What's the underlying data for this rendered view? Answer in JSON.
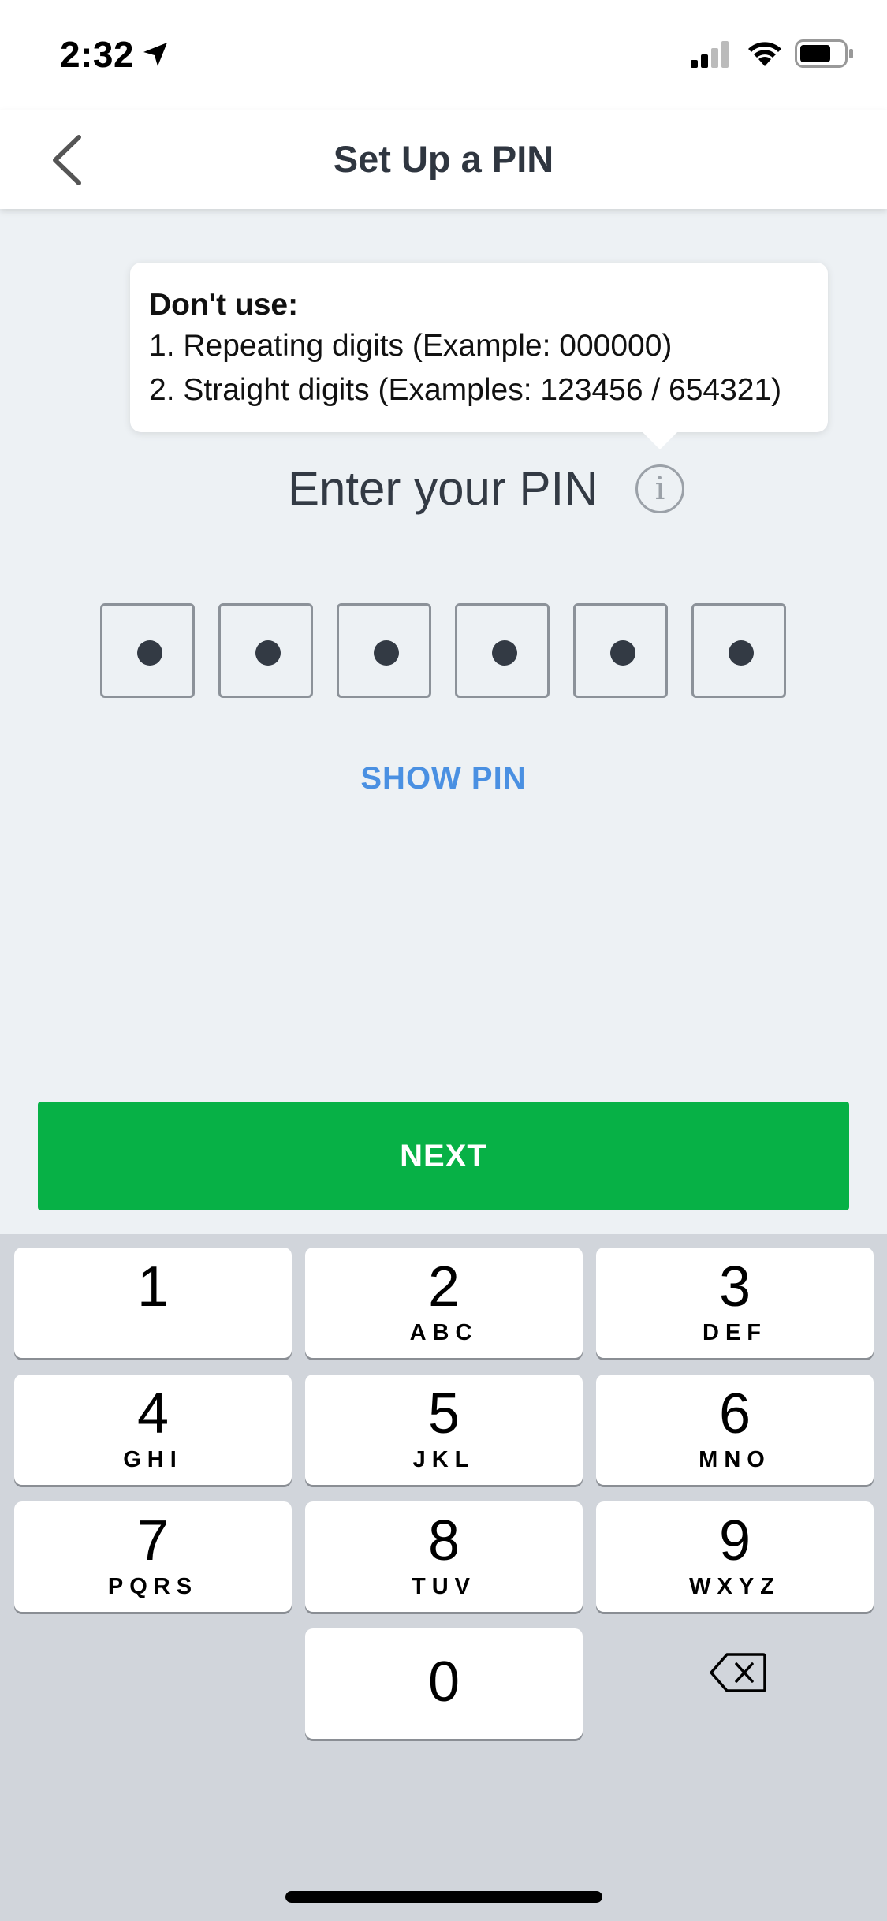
{
  "status_bar": {
    "time": "2:32",
    "icons": [
      "location-arrow-icon",
      "signal-icon",
      "wifi-icon",
      "battery-icon"
    ]
  },
  "nav": {
    "title": "Set Up a PIN",
    "back_icon": "chevron-left-icon"
  },
  "tooltip": {
    "heading": "Don't use:",
    "lines": [
      "1. Repeating digits (Example: 000000)",
      "2. Straight digits (Examples: 123456 / 654321)"
    ]
  },
  "pin": {
    "prompt": "Enter your PIN",
    "info_icon": "i",
    "digit_count": 6,
    "filled_count": 6,
    "show_label": "SHOW PIN"
  },
  "next_label": "NEXT",
  "keypad": {
    "keys": [
      {
        "num": "1",
        "letters": ""
      },
      {
        "num": "2",
        "letters": "ABC"
      },
      {
        "num": "3",
        "letters": "DEF"
      },
      {
        "num": "4",
        "letters": "GHI"
      },
      {
        "num": "5",
        "letters": "JKL"
      },
      {
        "num": "6",
        "letters": "MNO"
      },
      {
        "num": "7",
        "letters": "PQRS"
      },
      {
        "num": "8",
        "letters": "TUV"
      },
      {
        "num": "9",
        "letters": "WXYZ"
      },
      {
        "num": "0",
        "letters": ""
      }
    ],
    "backspace_icon": "backspace-icon"
  },
  "colors": {
    "accent_green": "#07b146",
    "link_blue": "#4a90e2",
    "background": "#edf1f4",
    "keypad_bg": "#d1d5db"
  }
}
